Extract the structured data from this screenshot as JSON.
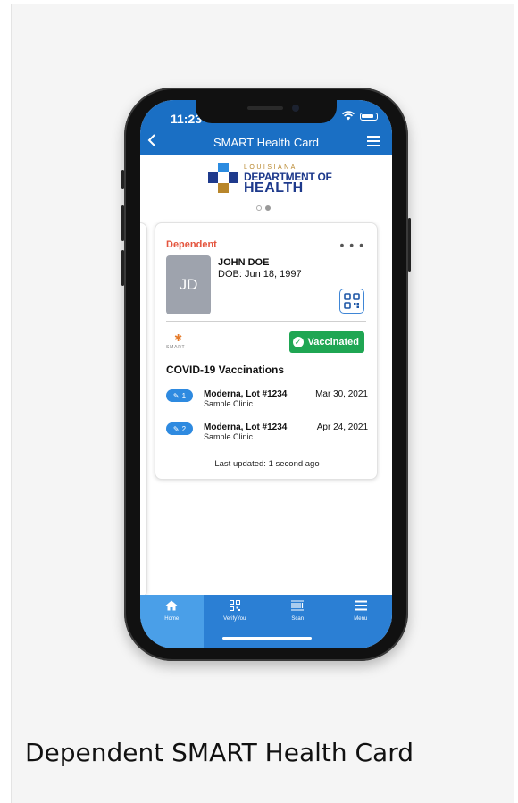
{
  "caption": "Dependent SMART Health Card",
  "status_bar": {
    "time": "11:23"
  },
  "app_bar": {
    "title": "SMART Health Card",
    "back_icon": "chevron-left-icon",
    "menu_icon": "hamburger-icon"
  },
  "logo": {
    "line1": "LOUISIANA",
    "line2": "DEPARTMENT OF",
    "line3": "HEALTH"
  },
  "pager": {
    "count": 2,
    "active": 2
  },
  "card": {
    "relationship": "Dependent",
    "more_label": "• • •",
    "avatar_initials": "JD",
    "name": "JOHN DOE",
    "dob": "DOB: Jun 18, 1997",
    "issuer_logo": "SMART",
    "status": "Vaccinated",
    "section_title": "COVID-19 Vaccinations",
    "doses": [
      {
        "number": "1",
        "vaccine": "Moderna, Lot #1234",
        "clinic": "Sample Clinic",
        "date": "Mar 30, 2021"
      },
      {
        "number": "2",
        "vaccine": "Moderna, Lot #1234",
        "clinic": "Sample Clinic",
        "date": "Apr 24, 2021"
      }
    ],
    "last_updated": "Last updated: 1 second ago"
  },
  "bottom_nav": [
    {
      "label": "Home",
      "icon": "home-icon",
      "active": true
    },
    {
      "label": "VerifyYou",
      "icon": "qr-code-icon",
      "active": false
    },
    {
      "label": "Scan",
      "icon": "barcode-icon",
      "active": false
    },
    {
      "label": "Menu",
      "icon": "hamburger-icon",
      "active": false
    }
  ],
  "colors": {
    "primary": "#1a6fc4",
    "nav_bg": "#2b7fd4",
    "dependent_red": "#e4553e",
    "vaccinated_green": "#1fa653",
    "dose_pill": "#2e8ae0",
    "ldh_navy": "#1e3a8c",
    "ldh_gold": "#b8862b"
  }
}
